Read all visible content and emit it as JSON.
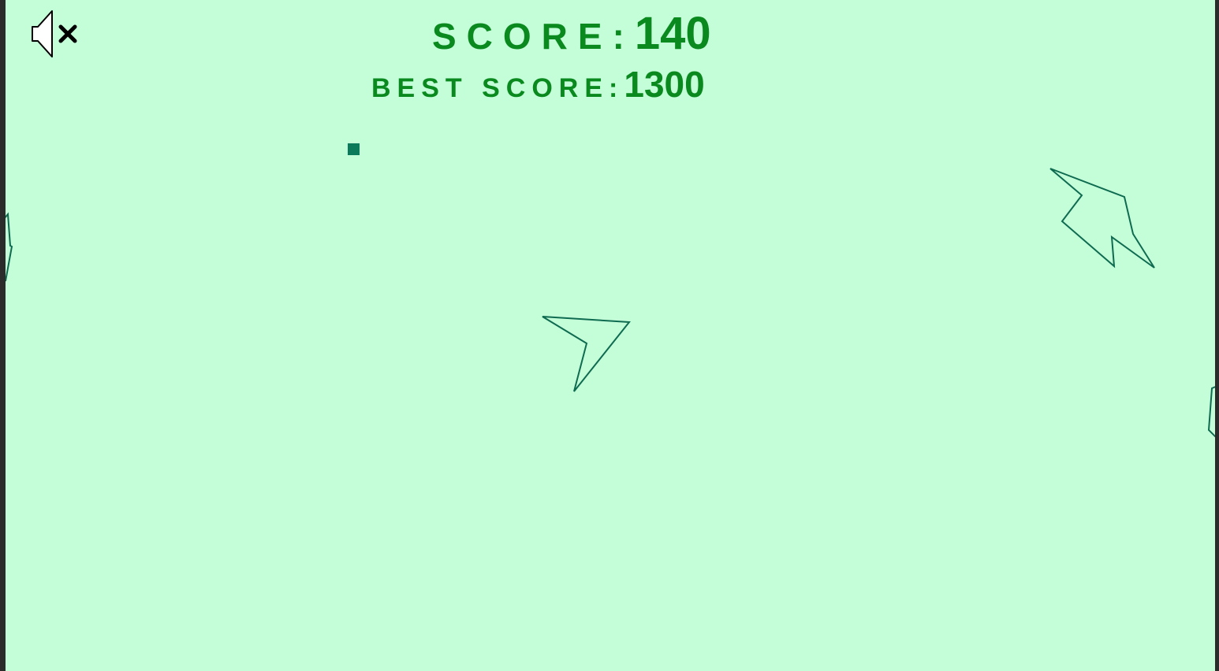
{
  "hud": {
    "score_label": "SCORE:",
    "score_value": "140",
    "best_label": "BEST SCORE:",
    "best_value": "1300"
  },
  "sound": {
    "icon": "speaker-muted-icon",
    "muted": true
  },
  "colors": {
    "background": "#c4fed9",
    "score_text": "#0a8a1e",
    "outline": "#0f6b50",
    "bullet": "#0a7a5a",
    "frame": "#2b2b2b"
  }
}
